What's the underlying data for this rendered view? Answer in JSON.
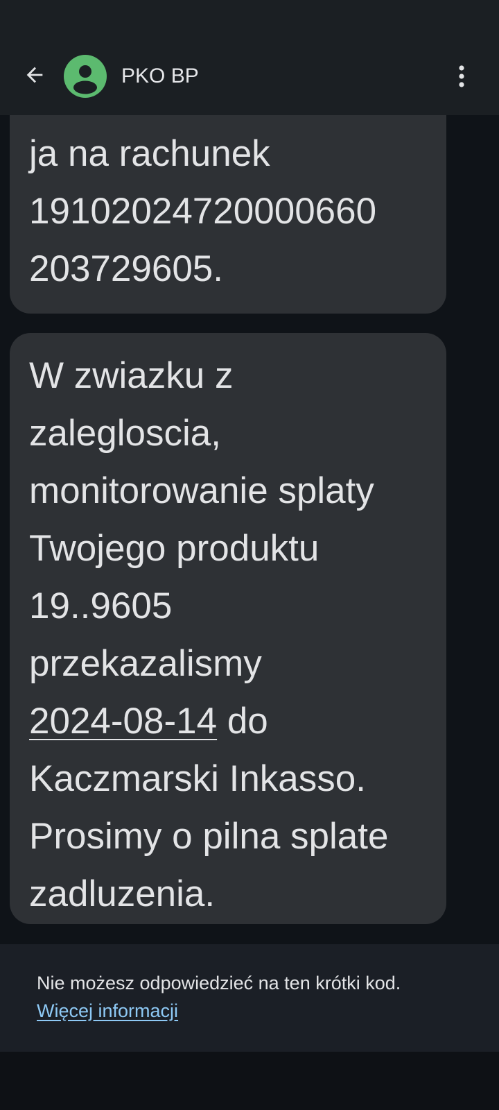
{
  "app_bar": {
    "contact_name": "PKO BP",
    "back_icon": "arrow-back-icon",
    "more_icon": "more-vert-icon",
    "avatar_icon": "person-icon",
    "avatar_color": "#5cba6f"
  },
  "messages": [
    {
      "lines": [
        "ja na rachunek",
        "19102024720000660",
        "203729605."
      ]
    },
    {
      "lines": [
        "W zwiazku z",
        "zalegloscia,",
        "monitorowanie splaty",
        "Twojego produktu",
        "19..9605",
        "przekazalismy"
      ],
      "date": "2024-08-14",
      "after_date": " do",
      "lines_after": [
        "Kaczmarski Inkasso.",
        "Prosimy o pilna splate",
        "zadluzenia."
      ]
    }
  ],
  "footer": {
    "notice": "Nie możesz odpowiedzieć na ten krótki kod.",
    "link": "Więcej informacji",
    "link_color": "#8ec9f5"
  }
}
